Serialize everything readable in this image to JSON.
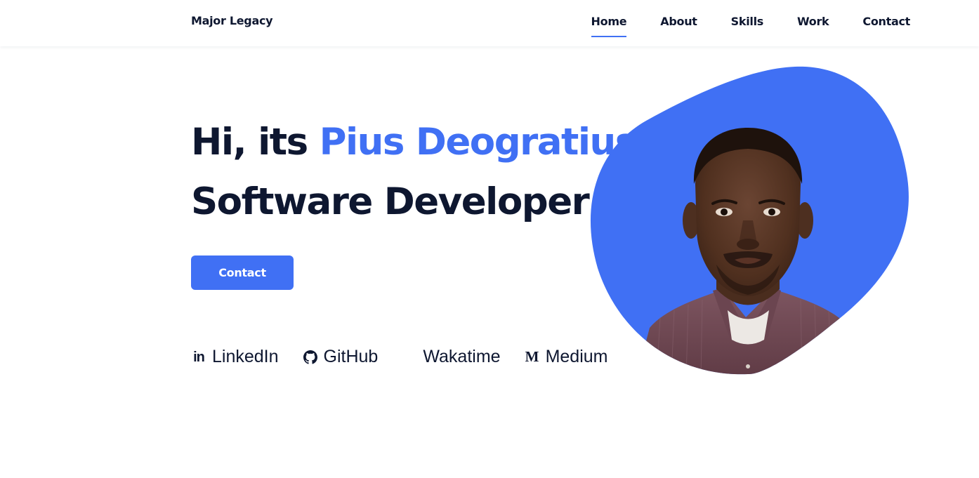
{
  "colors": {
    "accent": "#4070f4",
    "text": "#0e1730",
    "background": "#ffffff"
  },
  "header": {
    "logo": "Major Legacy",
    "nav": [
      {
        "label": "Home",
        "active": true
      },
      {
        "label": "About",
        "active": false
      },
      {
        "label": "Skills",
        "active": false
      },
      {
        "label": "Work",
        "active": false
      },
      {
        "label": "Contact",
        "active": false
      }
    ]
  },
  "hero": {
    "greeting": "Hi, its ",
    "name": "Pius Deogratius",
    "role": "Software Developer",
    "contact_button": "Contact",
    "portrait": "profile-photo"
  },
  "socials": [
    {
      "label": "LinkedIn",
      "icon": "linkedin-icon"
    },
    {
      "label": "GitHub",
      "icon": "github-icon"
    },
    {
      "label": "Wakatime",
      "icon": "wakatime-icon"
    },
    {
      "label": "Medium",
      "icon": "medium-icon"
    }
  ]
}
